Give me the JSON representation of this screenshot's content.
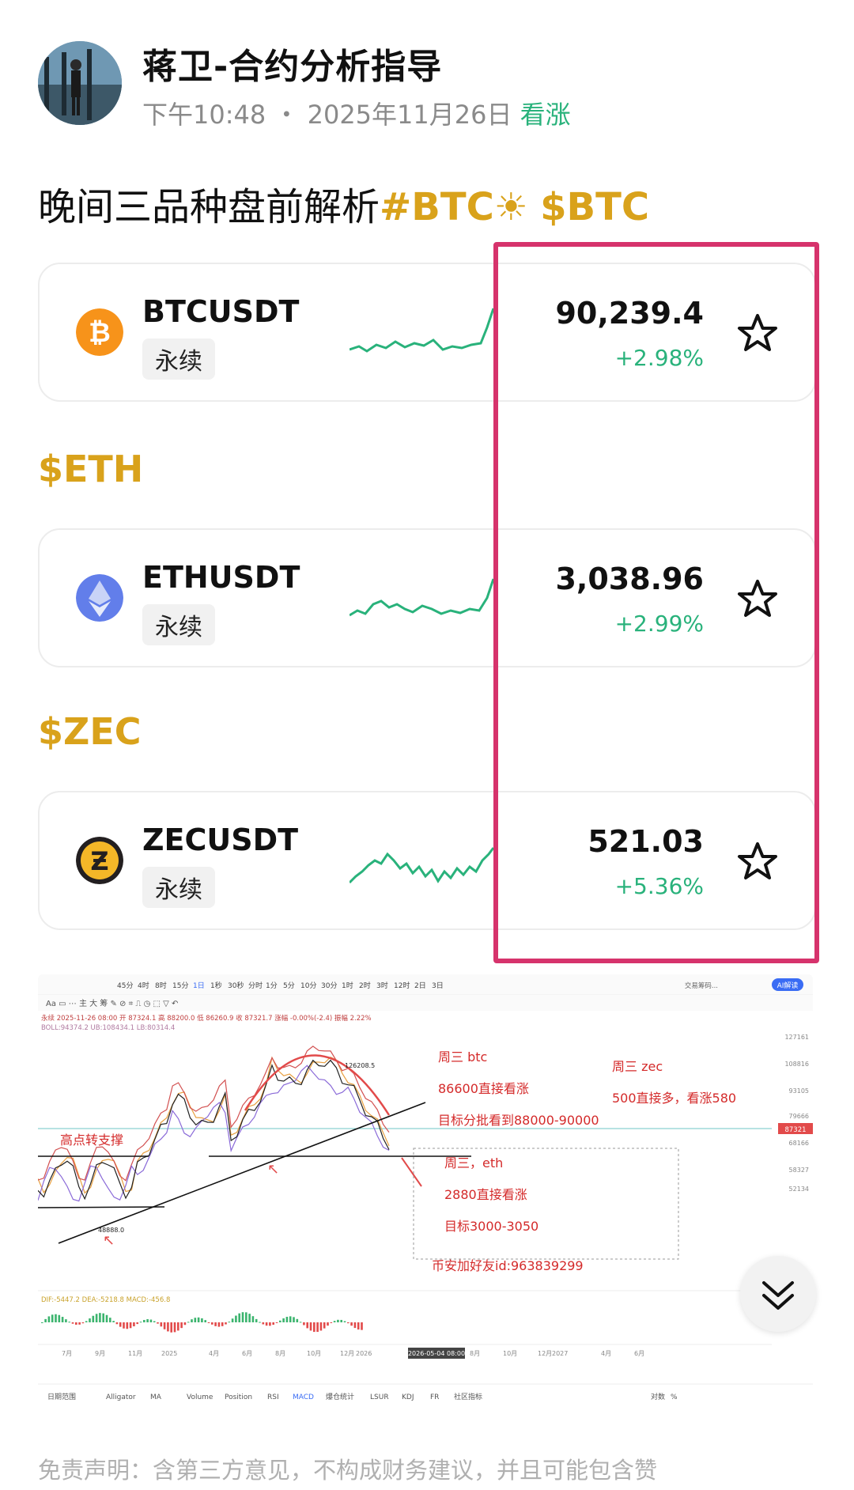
{
  "post": {
    "author": "蒋卫-合约分析指导",
    "time": "下午10:48",
    "separator": "・",
    "date": "2025年11月26日",
    "sentiment": "看涨",
    "title_text": "晚间三品种盘前解析",
    "title_tag1": "#BTC☀",
    "title_tag2": "$BTC"
  },
  "sections": {
    "eth": "$ETH",
    "zec": "$ZEC"
  },
  "tickers": [
    {
      "symbol": "BTCUSDT",
      "type": "永续",
      "price": "90,239.4",
      "change": "+2.98%",
      "icon": "bitcoin-icon",
      "color": "#f7931a"
    },
    {
      "symbol": "ETHUSDT",
      "type": "永续",
      "price": "3,038.96",
      "change": "+2.99%",
      "icon": "ethereum-icon",
      "color": "#627eea"
    },
    {
      "symbol": "ZECUSDT",
      "type": "永续",
      "price": "521.03",
      "change": "+5.36%",
      "icon": "zcash-icon",
      "color": "#f4b728"
    }
  ],
  "chart": {
    "timeframes": [
      "45分",
      "4时",
      "8时",
      "15分",
      "1日",
      "1秒",
      "30秒",
      "分时",
      "1分",
      "5分",
      "10分",
      "30分",
      "1时",
      "2时",
      "3时",
      "12时",
      "2日",
      "3日"
    ],
    "ai_button": "AI解读",
    "exchange_label": "交易筹码...",
    "info_line": "永续 2025-11-26 08:00 开 87324.1 高 88200.0 低 86260.9 收 87321.7 涨幅 -0.00%(-2.4) 振幅 2.22%",
    "boll_line": "BOLL:94374.2 UB:108434.1 LB:80314.4",
    "annotations": {
      "btc_title": "周三 btc",
      "btc_line1": "86600直接看涨",
      "btc_line2": "目标分批看到88000-90000",
      "zec_title": "周三 zec",
      "zec_line": "500直接多，看涨580",
      "eth_title": "周三，eth",
      "eth_line1": "2880直接看涨",
      "eth_line2": "目标3000-3050",
      "contact": "币安加好友id:963839299",
      "support": "高点转支撑",
      "high_label": "126208.5",
      "low_label": "48888.0"
    },
    "price_axis": [
      "127161",
      "108816",
      "93105",
      "87321",
      "79666",
      "68166",
      "58327",
      "52134"
    ],
    "current_price_tag": "87321",
    "macd_line": "DIF:-5447.2 DEA:-5218.8 MACD:-456.8",
    "time_axis": [
      "7月",
      "9月",
      "11月",
      "2025",
      "4月",
      "6月",
      "8月",
      "10月",
      "12月",
      "2026",
      "2026-05-04 08:00",
      "8月",
      "10月",
      "12月",
      "2027",
      "4月",
      "6月"
    ],
    "bottom_tabs": [
      "日期范围",
      "Alligator",
      "MA",
      "Volume",
      "Position",
      "RSI",
      "MACD",
      "爆仓统计",
      "LSUR",
      "KDJ",
      "FR",
      "社区指标",
      "对数",
      "%"
    ]
  },
  "disclaimer": "免责声明：含第三方意见，不构成财务建议，并且可能包含赞"
}
